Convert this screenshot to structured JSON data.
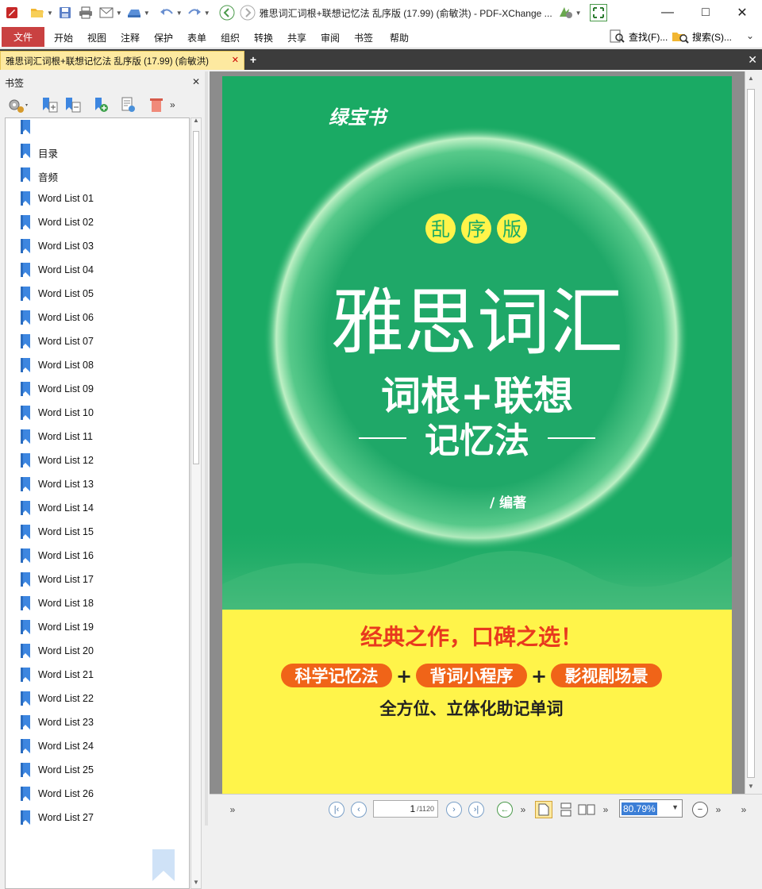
{
  "window": {
    "title": "雅思词汇词根+联想记忆法 乱序版 (17.99) (俞敏洪)  - PDF-XChange ..."
  },
  "menu": {
    "file": "文件",
    "items": [
      "开始",
      "视图",
      "注释",
      "保护",
      "表单",
      "组织",
      "转换",
      "共享",
      "审阅",
      "书签",
      "帮助"
    ],
    "find": "查找(F)...",
    "search": "搜索(S)..."
  },
  "tab": {
    "label": "雅思词汇词根+联想记忆法 乱序版 (17.99) (俞敏洪)"
  },
  "bookmarks": {
    "title": "书签",
    "items": [
      "",
      "目录",
      "音频",
      "Word List 01",
      "Word List 02",
      "Word List 03",
      "Word List 04",
      "Word List 05",
      "Word List 06",
      "Word List 07",
      "Word List 08",
      "Word List 09",
      "Word List 10",
      "Word List 11",
      "Word List 12",
      "Word List 13",
      "Word List 14",
      "Word List 15",
      "Word List 16",
      "Word List 17",
      "Word List 18",
      "Word List 19",
      "Word List 20",
      "Word List 21",
      "Word List 22",
      "Word List 23",
      "Word List 24",
      "Word List 25",
      "Word List 26",
      "Word List 27"
    ]
  },
  "cover": {
    "brand": "绿宝书",
    "edition": [
      "乱",
      "序",
      "版"
    ],
    "title_main": "雅思词汇",
    "title_sub": "词根+联想",
    "title_sub2": "记忆法",
    "author": "/ 编著",
    "slogan": "经典之作，口碑之选！",
    "pills": [
      "科学记忆法",
      "背词小程序",
      "影视剧场景"
    ],
    "plus": "+",
    "tagline": "全方位、立体化助记单词",
    "colors": {
      "green": "#1aaa64",
      "yellow": "#fff44a",
      "orange": "#f06418",
      "red": "#e8391e"
    }
  },
  "status": {
    "page_current": "1",
    "page_total": "/1120",
    "zoom": "80.79%"
  }
}
